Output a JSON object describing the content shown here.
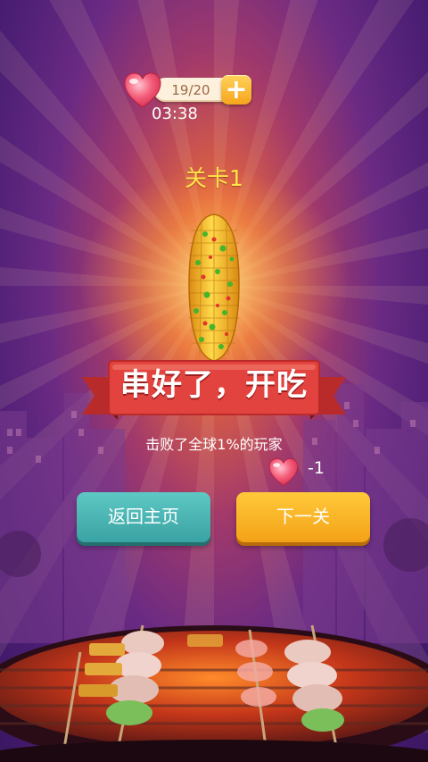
{
  "lives": {
    "count": "19/20",
    "timer": "03:38",
    "add_symbol": "+"
  },
  "level": {
    "title": "关卡1"
  },
  "banner": {
    "text": "串好了，开吃"
  },
  "result": {
    "text": "击败了全球1%的玩家",
    "lives_penalty": "-1"
  },
  "buttons": {
    "home_label": "返回主页",
    "next_label": "下一关"
  },
  "colors": {
    "title_yellow": "#ffe34a",
    "banner_red": "#e2433f",
    "home_teal": "#4bb6b4",
    "next_orange": "#f7b025",
    "heart_pink": "#f2506e"
  },
  "icons": {
    "heart": "heart-icon",
    "plus": "plus-icon",
    "corn": "corn-cob-icon",
    "grill": "bbq-grill-illustration"
  }
}
